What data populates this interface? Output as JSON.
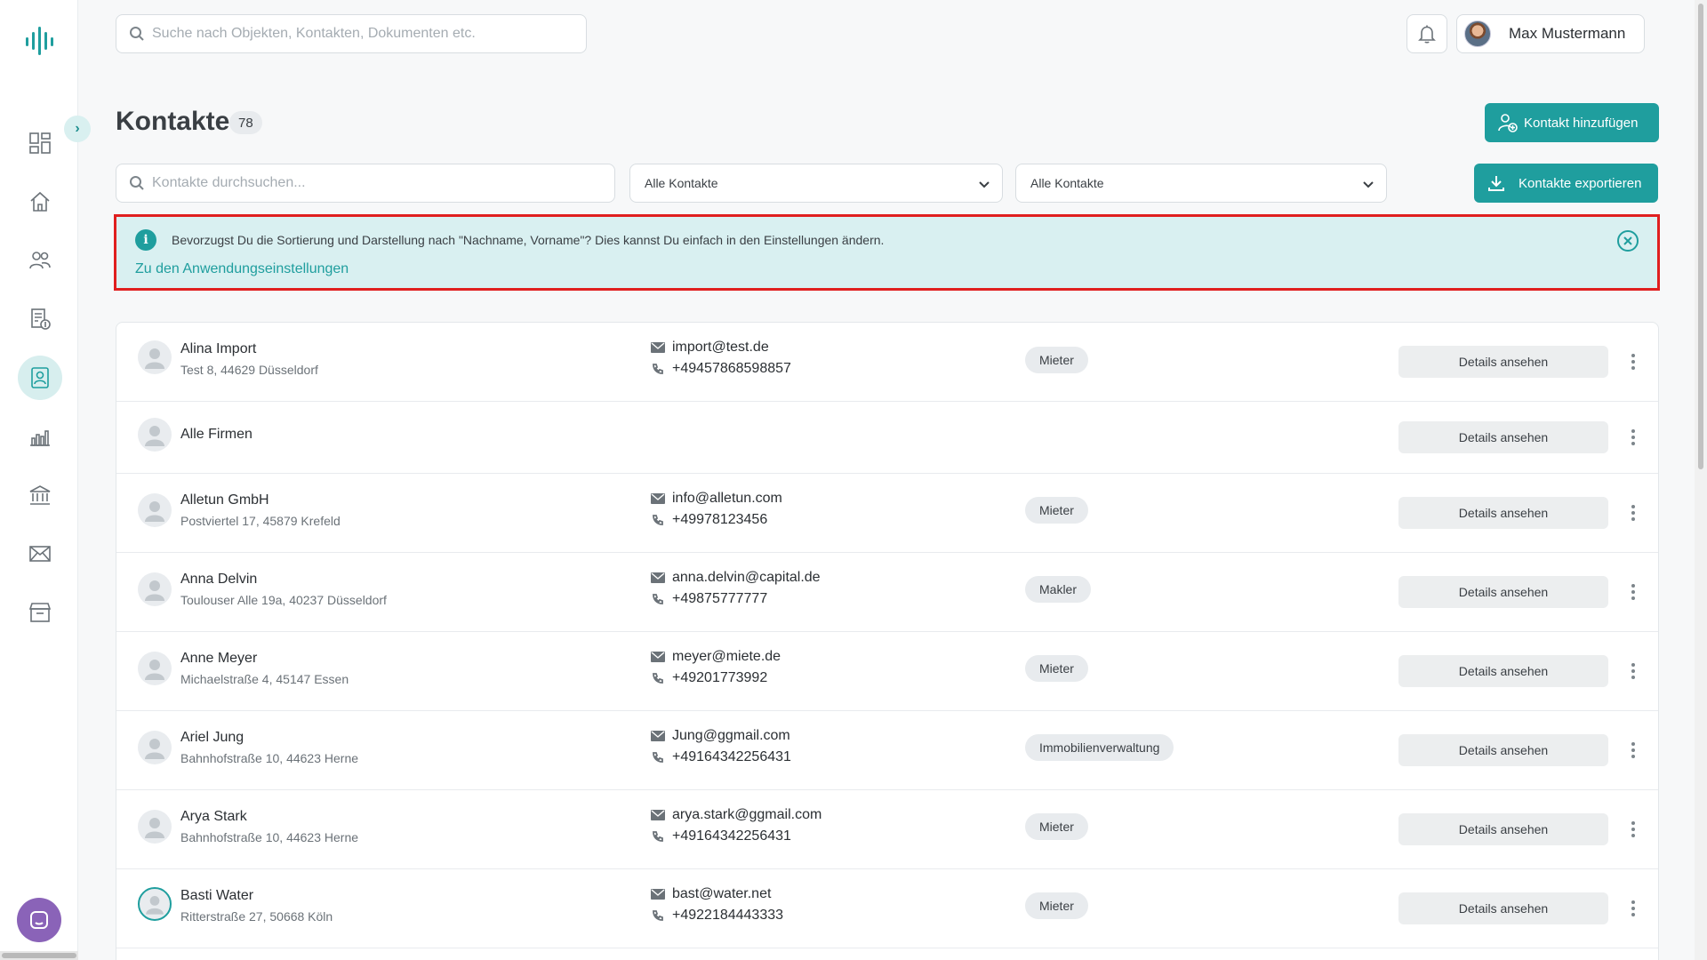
{
  "colors": {
    "accent": "#1f9e9e",
    "highlight_border": "#e01f1f",
    "banner_bg": "#d9f0f1",
    "chat": "#8a63b8"
  },
  "sidebar": {
    "items": [
      {
        "icon": "dashboard-icon",
        "active": false
      },
      {
        "icon": "home-icon",
        "active": false
      },
      {
        "icon": "users-icon",
        "active": false
      },
      {
        "icon": "billing-icon",
        "active": false
      },
      {
        "icon": "contacts-icon",
        "active": true
      },
      {
        "icon": "chart-icon",
        "active": false
      },
      {
        "icon": "bank-icon",
        "active": false
      },
      {
        "icon": "mail-icon",
        "active": false
      },
      {
        "icon": "archive-icon",
        "active": false
      }
    ]
  },
  "topbar": {
    "search_placeholder": "Suche nach Objekten, Kontakten, Dokumenten etc.",
    "user_name": "Max Mustermann"
  },
  "header": {
    "title": "Kontakte",
    "count": "78",
    "add_label": "Kontakt hinzufügen",
    "export_label": "Kontakte exportieren"
  },
  "filters": {
    "search_placeholder": "Kontakte durchsuchen...",
    "select1": "Alle Kontakte",
    "select2": "Alle Kontakte"
  },
  "banner": {
    "message": "Bevorzugst Du die Sortierung und Darstellung nach \"Nachname, Vorname\"? Dies kannst Du einfach in den Einstellungen ändern.",
    "link": "Zu den Anwendungseinstellungen"
  },
  "contacts": [
    {
      "name": "Alina Import",
      "address": "Test 8, 44629 Düsseldorf",
      "email": "import@test.de",
      "phone": "+49457868598857",
      "tag": "Mieter",
      "details": "Details ansehen"
    },
    {
      "name": "Alle Firmen",
      "address": "",
      "email": "",
      "phone": "",
      "tag": "",
      "details": "Details ansehen"
    },
    {
      "name": "Alletun GmbH",
      "address": "Postviertel 17, 45879 Krefeld",
      "email": "info@alletun.com",
      "phone": "+49978123456",
      "tag": "Mieter",
      "details": "Details ansehen"
    },
    {
      "name": "Anna Delvin",
      "address": "Toulouser Alle 19a, 40237 Düsseldorf",
      "email": "anna.delvin@capital.de",
      "phone": "+49875777777",
      "tag": "Makler",
      "details": "Details ansehen"
    },
    {
      "name": "Anne Meyer",
      "address": "Michaelstraße 4, 45147 Essen",
      "email": "meyer@miete.de",
      "phone": "+49201773992",
      "tag": "Mieter",
      "details": "Details ansehen"
    },
    {
      "name": "Ariel Jung",
      "address": "Bahnhofstraße 10, 44623 Herne",
      "email": "Jung@ggmail.com",
      "phone": "+49164342256431",
      "tag": "Immobilienverwaltung",
      "details": "Details ansehen"
    },
    {
      "name": "Arya Stark",
      "address": "Bahnhofstraße 10, 44623 Herne",
      "email": "arya.stark@ggmail.com",
      "phone": "+49164342256431",
      "tag": "Mieter",
      "details": "Details ansehen"
    },
    {
      "name": "Basti Water",
      "address": "Ritterstraße 27, 50668 Köln",
      "email": "bast@water.net",
      "phone": "+4922184443333",
      "tag": "Mieter",
      "details": "Details ansehen"
    }
  ]
}
